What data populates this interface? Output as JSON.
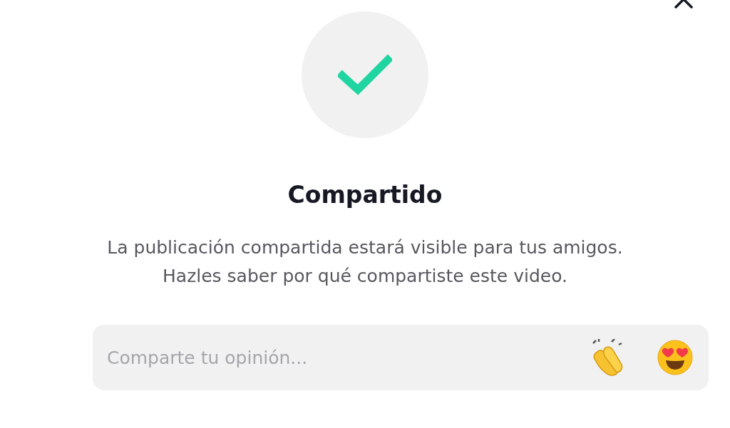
{
  "dialog": {
    "title": "Compartido",
    "message": "La publicación compartida estará visible para tus amigos.\nHazles saber por qué compartiste este video.",
    "comment": {
      "placeholder": "Comparte tu opinión..."
    }
  }
}
